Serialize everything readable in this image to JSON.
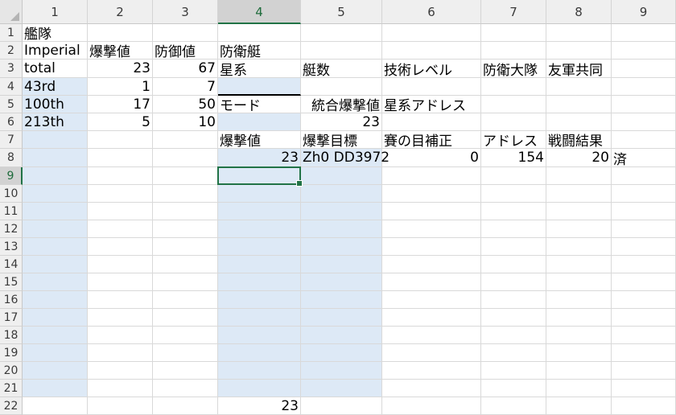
{
  "sheet": {
    "columns": [
      "1",
      "2",
      "3",
      "4",
      "5",
      "6",
      "7",
      "8",
      "9"
    ],
    "selected_column": "4",
    "selected_row": "9",
    "selection_color": "#217346",
    "fill_color": "#dde9f6",
    "rows": [
      {
        "label": "1",
        "cells": {
          "1": "艦隊"
        }
      },
      {
        "label": "2",
        "cells": {
          "1": "Imperial",
          "2": "爆撃値",
          "3": "防御値",
          "4": "防衛艇"
        }
      },
      {
        "label": "3",
        "cells": {
          "1": "total",
          "2": "23",
          "3": "67",
          "4": "星系",
          "5": "艇数",
          "6": "技術レベル",
          "7": "防衛大隊",
          "8": "友軍共同"
        }
      },
      {
        "label": "4",
        "cells": {
          "1": "43rd",
          "2": "1",
          "3": "7"
        }
      },
      {
        "label": "5",
        "cells": {
          "1": "100th",
          "2": "17",
          "3": "50",
          "4": "モード",
          "5": "統合爆撃値",
          "6": "星系アドレス"
        }
      },
      {
        "label": "6",
        "cells": {
          "1": "213th",
          "2": "5",
          "3": "10",
          "5": "23"
        }
      },
      {
        "label": "7",
        "cells": {
          "4": "爆撃値",
          "5": "爆撃目標",
          "6": "賽の目補正",
          "7": "アドレス",
          "8": "戦闘結果"
        }
      },
      {
        "label": "8",
        "cells": {
          "4": "23",
          "5": "Zh0 DD3972",
          "6": "0",
          "7": "154",
          "8": "20",
          "9": "済"
        }
      },
      {
        "label": "9",
        "cells": {}
      },
      {
        "label": "10",
        "cells": {}
      },
      {
        "label": "11",
        "cells": {}
      },
      {
        "label": "12",
        "cells": {}
      },
      {
        "label": "13",
        "cells": {}
      },
      {
        "label": "14",
        "cells": {}
      },
      {
        "label": "15",
        "cells": {}
      },
      {
        "label": "16",
        "cells": {}
      },
      {
        "label": "17",
        "cells": {}
      },
      {
        "label": "18",
        "cells": {}
      },
      {
        "label": "19",
        "cells": {}
      },
      {
        "label": "20",
        "cells": {}
      },
      {
        "label": "21",
        "cells": {}
      },
      {
        "label": "22",
        "cells": {
          "4": "23"
        }
      }
    ]
  }
}
